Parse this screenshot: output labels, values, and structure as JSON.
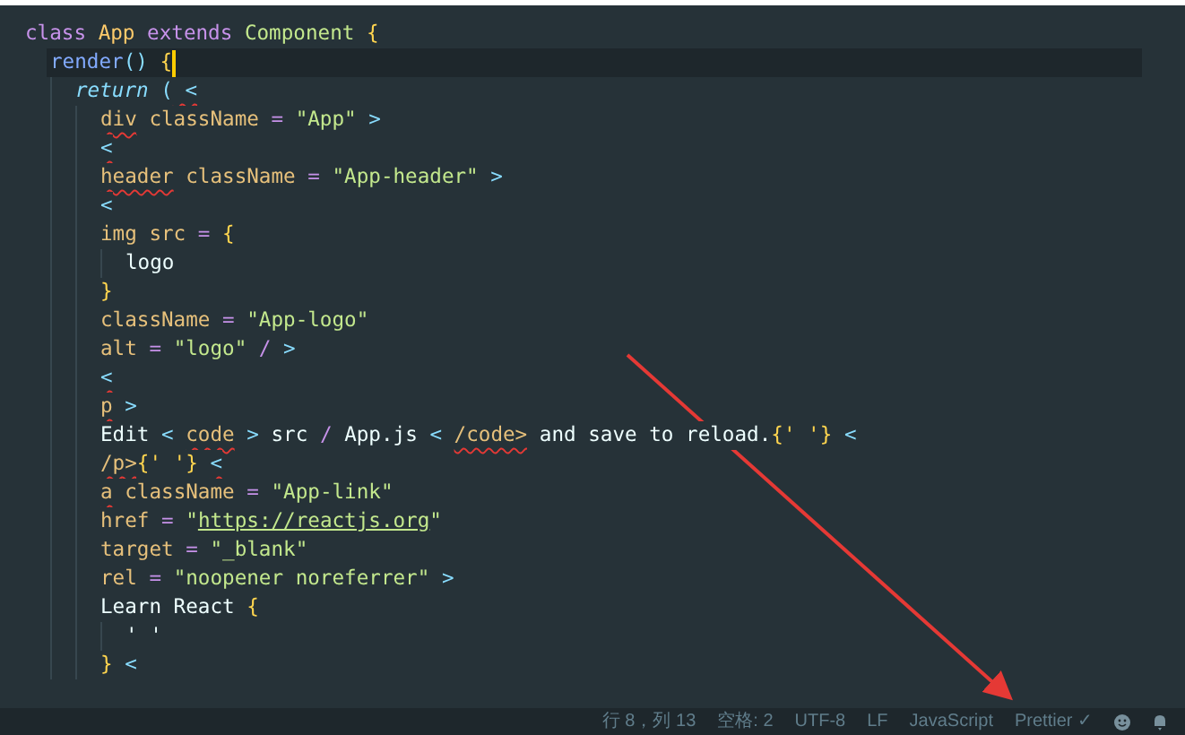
{
  "editor": {
    "lines": [
      {
        "tokens": [
          {
            "text": "class",
            "kind": "keyword"
          },
          {
            "text": " App",
            "kind": "type"
          },
          {
            "text": " extends",
            "kind": "keyword"
          },
          {
            "text": " Component",
            "kind": "class"
          },
          {
            "text": " {",
            "kind": "brace"
          }
        ],
        "highlighted": false,
        "children": [
          {
            "tokens": [
              {
                "text": "render",
                "kind": "function"
              },
              {
                "text": "()",
                "kind": "punct"
              },
              {
                "text": " {",
                "kind": "brace"
              }
            ],
            "highlighted": true,
            "children": [
              {
                "tokens": [
                  {
                    "text": "return",
                    "kind": "control"
                  },
                  {
                    "text": " (",
                    "kind": "punct"
                  },
                  {
                    "text": " <",
                    "kind": "punct",
                    "squiggle": true
                  }
                ],
                "highlighted": false,
                "children": [
                  {
                    "tokens": [
                      {
                        "text": "div",
                        "kind": "tag",
                        "squiggle": true
                      },
                      {
                        "text": " className",
                        "kind": "tag"
                      },
                      {
                        "text": " =",
                        "kind": "operator"
                      },
                      {
                        "text": " \"App\"",
                        "kind": "string"
                      },
                      {
                        "text": " >",
                        "kind": "punct"
                      }
                    ],
                    "highlighted": false
                  },
                  {
                    "tokens": [
                      {
                        "text": "<",
                        "kind": "punct",
                        "squiggle": true
                      }
                    ],
                    "highlighted": false
                  },
                  {
                    "tokens": [
                      {
                        "text": "header",
                        "kind": "tag",
                        "squiggle": true
                      },
                      {
                        "text": " className",
                        "kind": "tag"
                      },
                      {
                        "text": " =",
                        "kind": "operator"
                      },
                      {
                        "text": " \"App-header\"",
                        "kind": "string"
                      },
                      {
                        "text": " >",
                        "kind": "punct"
                      }
                    ],
                    "highlighted": false
                  },
                  {
                    "tokens": [
                      {
                        "text": "<",
                        "kind": "punct"
                      }
                    ],
                    "highlighted": false
                  },
                  {
                    "tokens": [
                      {
                        "text": "img",
                        "kind": "tag"
                      },
                      {
                        "text": " src",
                        "kind": "tag"
                      },
                      {
                        "text": " =",
                        "kind": "operator"
                      },
                      {
                        "text": " {",
                        "kind": "brace"
                      }
                    ],
                    "highlighted": false,
                    "children": [
                      {
                        "tokens": [
                          {
                            "text": "logo",
                            "kind": "plain"
                          }
                        ],
                        "highlighted": false
                      }
                    ]
                  },
                  {
                    "tokens": [
                      {
                        "text": "}",
                        "kind": "brace"
                      }
                    ],
                    "highlighted": false
                  },
                  {
                    "tokens": [
                      {
                        "text": "className",
                        "kind": "tag"
                      },
                      {
                        "text": " =",
                        "kind": "operator"
                      },
                      {
                        "text": " \"App-logo\"",
                        "kind": "string"
                      }
                    ],
                    "highlighted": false
                  },
                  {
                    "tokens": [
                      {
                        "text": "alt",
                        "kind": "tag"
                      },
                      {
                        "text": " =",
                        "kind": "operator"
                      },
                      {
                        "text": " \"logo\"",
                        "kind": "string"
                      },
                      {
                        "text": " /",
                        "kind": "operator"
                      },
                      {
                        "text": " >",
                        "kind": "punct"
                      }
                    ],
                    "highlighted": false
                  },
                  {
                    "tokens": [
                      {
                        "text": "<",
                        "kind": "punct",
                        "squiggle": true
                      }
                    ],
                    "highlighted": false
                  },
                  {
                    "tokens": [
                      {
                        "text": "p",
                        "kind": "tag",
                        "squiggle": true
                      },
                      {
                        "text": " >",
                        "kind": "punct"
                      }
                    ],
                    "highlighted": false
                  },
                  {
                    "tokens": [
                      {
                        "text": "Edit",
                        "kind": "plain"
                      },
                      {
                        "text": " < ",
                        "kind": "punct"
                      },
                      {
                        "text": "code",
                        "kind": "tag",
                        "squiggle": true
                      },
                      {
                        "text": " >",
                        "kind": "punct"
                      },
                      {
                        "text": " src",
                        "kind": "plain"
                      },
                      {
                        "text": " /",
                        "kind": "operator"
                      },
                      {
                        "text": " App.js",
                        "kind": "plain"
                      },
                      {
                        "text": " < ",
                        "kind": "punct"
                      },
                      {
                        "text": "/code>",
                        "kind": "tag",
                        "squiggle": true
                      },
                      {
                        "text": " and save to reload.",
                        "kind": "plain"
                      },
                      {
                        "text": "{' '}",
                        "kind": "brace"
                      },
                      {
                        "text": " <",
                        "kind": "punct"
                      }
                    ],
                    "highlighted": false
                  },
                  {
                    "tokens": [
                      {
                        "text": "/p>",
                        "kind": "tag",
                        "squiggle": true
                      },
                      {
                        "text": "{' '} ",
                        "kind": "brace"
                      },
                      {
                        "text": "<",
                        "kind": "punct",
                        "squiggle": true
                      }
                    ],
                    "highlighted": false
                  },
                  {
                    "tokens": [
                      {
                        "text": "a",
                        "kind": "tag",
                        "squiggle": true
                      },
                      {
                        "text": " className",
                        "kind": "tag"
                      },
                      {
                        "text": " =",
                        "kind": "operator"
                      },
                      {
                        "text": " \"App-link\"",
                        "kind": "string"
                      }
                    ],
                    "highlighted": false
                  },
                  {
                    "tokens": [
                      {
                        "text": "href",
                        "kind": "tag"
                      },
                      {
                        "text": " =",
                        "kind": "operator"
                      },
                      {
                        "text": " \"",
                        "kind": "string"
                      },
                      {
                        "text": "https://reactjs.org",
                        "kind": "link"
                      },
                      {
                        "text": "\"",
                        "kind": "string"
                      }
                    ],
                    "highlighted": false
                  },
                  {
                    "tokens": [
                      {
                        "text": "target",
                        "kind": "tag"
                      },
                      {
                        "text": " =",
                        "kind": "operator"
                      },
                      {
                        "text": " \"_blank\"",
                        "kind": "string"
                      }
                    ],
                    "highlighted": false
                  },
                  {
                    "tokens": [
                      {
                        "text": "rel",
                        "kind": "tag"
                      },
                      {
                        "text": " =",
                        "kind": "operator"
                      },
                      {
                        "text": " \"noopener noreferrer\"",
                        "kind": "string"
                      },
                      {
                        "text": " >",
                        "kind": "punct"
                      }
                    ],
                    "highlighted": false
                  },
                  {
                    "tokens": [
                      {
                        "text": "Learn React",
                        "kind": "plain"
                      },
                      {
                        "text": " {",
                        "kind": "brace"
                      }
                    ],
                    "highlighted": false,
                    "children": [
                      {
                        "tokens": [
                          {
                            "text": "' '",
                            "kind": "plain"
                          }
                        ],
                        "highlighted": false
                      }
                    ]
                  },
                  {
                    "tokens": [
                      {
                        "text": "}",
                        "kind": "brace"
                      },
                      {
                        "text": " <",
                        "kind": "punct"
                      }
                    ],
                    "highlighted": false
                  }
                ]
              }
            ]
          }
        ]
      }
    ]
  },
  "status_bar": {
    "items": [
      "行 8，列 13",
      "空格: 2",
      "UTF-8",
      "LF",
      "JavaScript",
      "Prettier ✓"
    ]
  }
}
